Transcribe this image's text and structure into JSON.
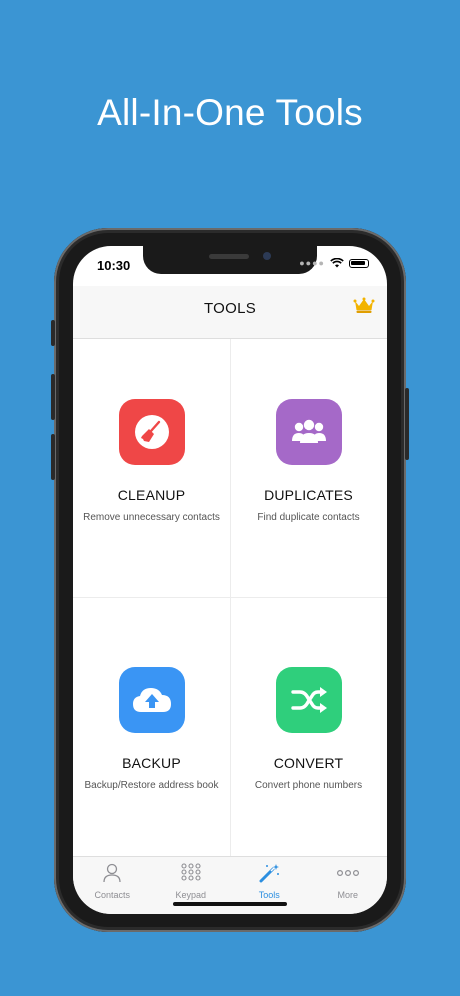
{
  "headline": "All-In-One Tools",
  "status_bar": {
    "time": "10:30"
  },
  "navbar": {
    "title": "TOOLS",
    "premium_icon": "crown-icon"
  },
  "tools": [
    {
      "title": "CLEANUP",
      "subtitle": "Remove unnecessary contacts",
      "icon": "broom-icon",
      "color": "#ef4747"
    },
    {
      "title": "DUPLICATES",
      "subtitle": "Find duplicate contacts",
      "icon": "people-group-icon",
      "color": "#a569c8"
    },
    {
      "title": "BACKUP",
      "subtitle": "Backup/Restore address book",
      "icon": "cloud-upload-icon",
      "color": "#3a95f4"
    },
    {
      "title": "CONVERT",
      "subtitle": "Convert phone numbers",
      "icon": "shuffle-icon",
      "color": "#2fcf7c"
    }
  ],
  "tabbar": {
    "items": [
      {
        "label": "Contacts",
        "icon": "person-icon"
      },
      {
        "label": "Keypad",
        "icon": "keypad-icon"
      },
      {
        "label": "Tools",
        "icon": "magic-wand-icon",
        "active": true
      },
      {
        "label": "More",
        "icon": "more-dots-icon"
      }
    ]
  },
  "colors": {
    "background": "#3b95d3",
    "tab_active": "#2c8fe0"
  }
}
